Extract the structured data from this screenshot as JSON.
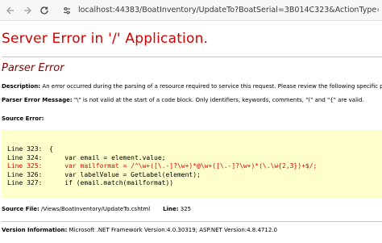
{
  "browser": {
    "url": "localhost:44383/BoatInventory/UpdateTo?BoatSerial=3B014C323&ActionType=RT"
  },
  "error": {
    "title": "Server Error in '/' Application.",
    "subtitle": "Parser Error",
    "description_label": "Description:",
    "description_text": "An error occurred during the parsing of a resource required to service this request. Please review the following specific parse error details",
    "message_label": "Parser Error Message:",
    "message_text": "\"\\\" is not valid at the start of a code block.  Only identifiers, keywords, comments, \"(\" and \"{\" are valid.",
    "source_error_label": "Source Error:",
    "source_lines": [
      {
        "line": "Line 323:",
        "code": "{"
      },
      {
        "line": "Line 324:",
        "code": "    var email = element.value;"
      },
      {
        "line": "Line 325:",
        "code": "    var mailformat = /^\\w+([\\.-]?\\w+)*@\\w+([\\.-]?\\w+)*(\\.\\w{2,3})+$/;"
      },
      {
        "line": "Line 326:",
        "code": "    var labelValue = GetLabel(element);"
      },
      {
        "line": "Line 327:",
        "code": "    if (email.match(mailformat))"
      }
    ],
    "error_line_index": 2,
    "source_file_label": "Source File:",
    "source_file_path": "/Views/BoatInventory/UpdateTo.cshtml",
    "line_label": "Line:",
    "line_number": "325",
    "version_label": "Version Information:",
    "version_text": "Microsoft .NET Framework Version:4.0.30319; ASP.NET Version:4.8.4712.0"
  },
  "colors": {
    "title": "#d40000",
    "subtitle": "#8b0000",
    "error_line": "#e00000",
    "code_background": "#ffffcc"
  }
}
